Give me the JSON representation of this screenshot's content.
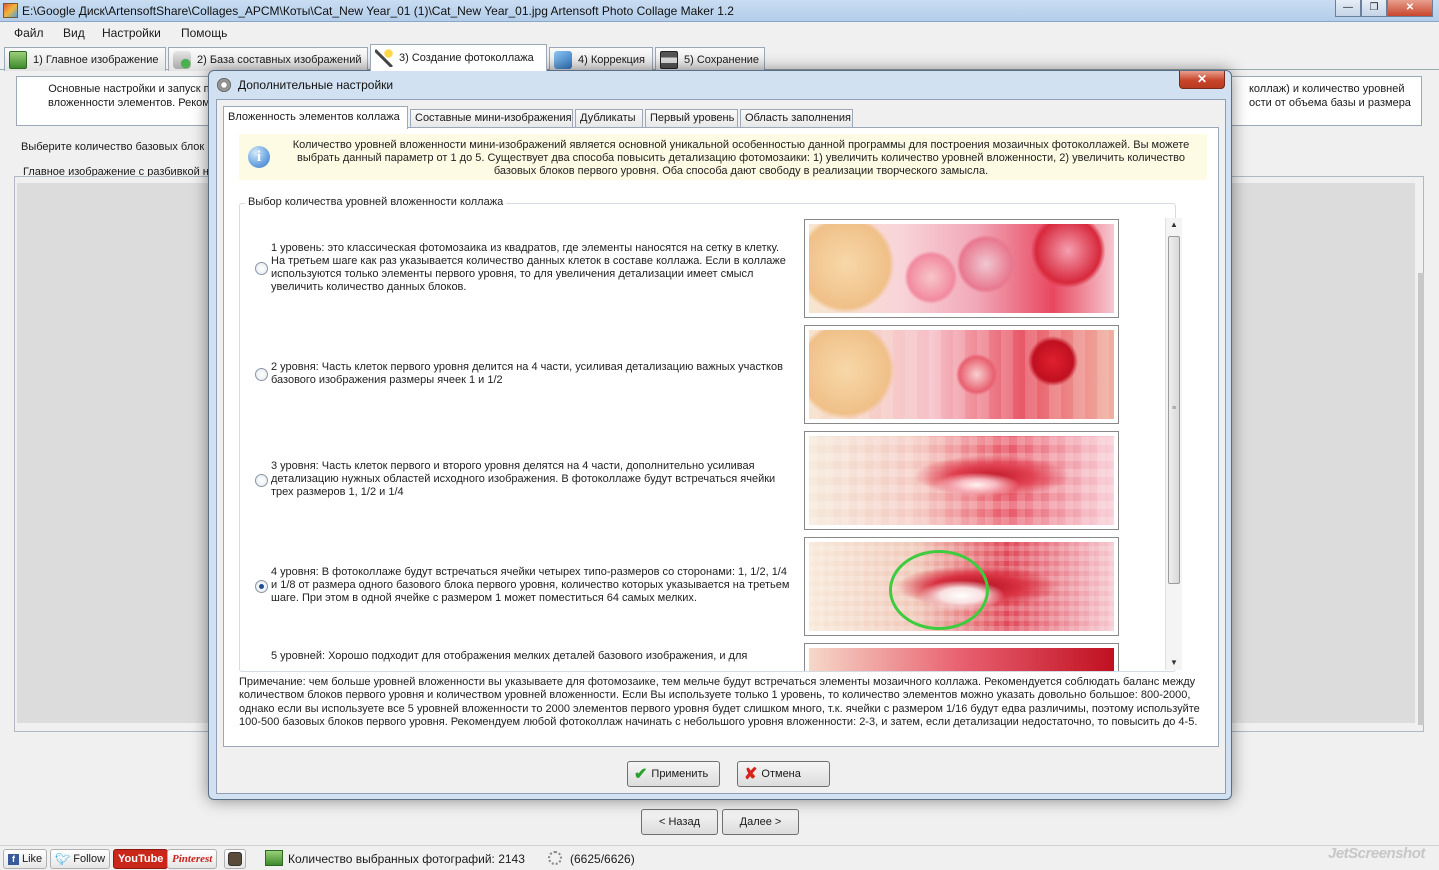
{
  "window": {
    "title": "E:\\Google Диск\\ArtensoftShare\\Collages_APCM\\Коты\\Cat_New Year_01 (1)\\Cat_New Year_01.jpg Artensoft Photo Collage Maker 1.2",
    "min": "—",
    "max": "❐",
    "close": "✕"
  },
  "menu": [
    "Файл",
    "Вид",
    "Настройки",
    "Помощь"
  ],
  "main_tabs": [
    {
      "label": "1) Главное изображение",
      "icon": "picture-icon"
    },
    {
      "label": "2) База составных изображений",
      "icon": "database-add-icon"
    },
    {
      "label": "3) Создание фотоколлажа",
      "icon": "magic-wand-icon"
    },
    {
      "label": "4) Коррекция",
      "icon": "cube-icon"
    },
    {
      "label": "5) Сохранение",
      "icon": "floppy-disk-icon"
    }
  ],
  "background": {
    "desc_left": "Основные настройки и запуск пр вложенности элементов. Рекоме",
    "desc_right": "коллаж) и количество уровней ости от объема базы и размера",
    "choose_label": "Выберите количество базовых блок",
    "main_image_label": "Главное изображение с разбивкой н",
    "back": "< Назад",
    "next": "Далее >"
  },
  "dialog": {
    "title": "Дополнительные настройки",
    "close": "✕",
    "tabs": [
      "Вложенность элементов коллажа",
      "Составные мини-изображения",
      "Дубликаты",
      "Первый уровень",
      "Область заполнения"
    ],
    "info_icon": "i",
    "info_text": "Количество уровней вложенности мини-изображений является основной уникальной особенностью данной программы для построения мозаичных фотоколлажей. Вы можете выбрать данный параметр от 1 до 5. Существует два способа повысить детализацию фотомозаики: 1) увеличить количество уровней вложенности, 2) увеличить количество базовых блоков первого уровня. Оба способа дают свободу в реализации творческого замысла.",
    "group_label": "Выбор количества уровней вложенности коллажа",
    "options": [
      {
        "text": "1 уровень: это классическая фотомозаика из квадратов, где элементы наносятся на сетку в клетку. На третьем шаге как раз указывается количество данных клеток в составе коллажа. Если в коллаже используются только элементы первого уровня, то для увеличения детализации имеет смысл увеличить количество данных блоков.",
        "checked": false
      },
      {
        "text": "2 уровня: Часть клеток первого уровня делится на 4 части, усиливая детализацию важных участков базового изображения размеры ячеек 1 и 1/2",
        "checked": false
      },
      {
        "text": "3 уровня: Часть клеток первого и второго уровня делятся на 4 части, дополнительно усиливая детализацию нужных областей исходного изображения. В фотоколлаже будут встречаться ячейки трех размеров 1, 1/2 и 1/4",
        "checked": false
      },
      {
        "text": "4 уровня: В фотоколлаже будут встречаться ячейки четырех типо-размеров со сторонами: 1, 1/2, 1/4 и 1/8 от размера одного базового блока первого уровня, количество которых указывается на третьем шаге. При этом в одной ячейке с размером 1 может поместиться 64 самых мелких.",
        "checked": true
      },
      {
        "text": "5 уровней: Хорошо подходит для отображения мелких деталей базового изображения, и для",
        "checked": false
      }
    ],
    "note": "Примечание: чем больше уровней вложенности вы указываете для фотомозаике, тем мельче будут встречаться элементы мозаичного коллажа. Рекомендуется соблюдать баланс между количеством блоков первого уровня и количеством уровней вложенности. Если Вы используете только 1 уровень, то количество элементов можно указать довольно большое: 800-2000, однако если вы используете все 5 уровней вложенности то 2000 элементов первого уровня будет слишком много, т.к. ячейки с размером 1/16 будут едва различимы, поэтому используйте 100-500 базовых блоков первого уровня. Рекомендуем любой фотоколлаж начинать с небольшого уровня вложенности: 2-3, и затем, если детализации недостаточно, то повысить до 4-5.",
    "apply": "Применить",
    "cancel": "Отмена"
  },
  "statusbar": {
    "like": "Like",
    "follow": "Follow",
    "youtube": "YouTube",
    "pinterest": "Pinterest",
    "photos_count": "Количество выбранных фотографий: 2143",
    "progress": "(6625/6626)"
  },
  "watermark": "JetScreenshot"
}
